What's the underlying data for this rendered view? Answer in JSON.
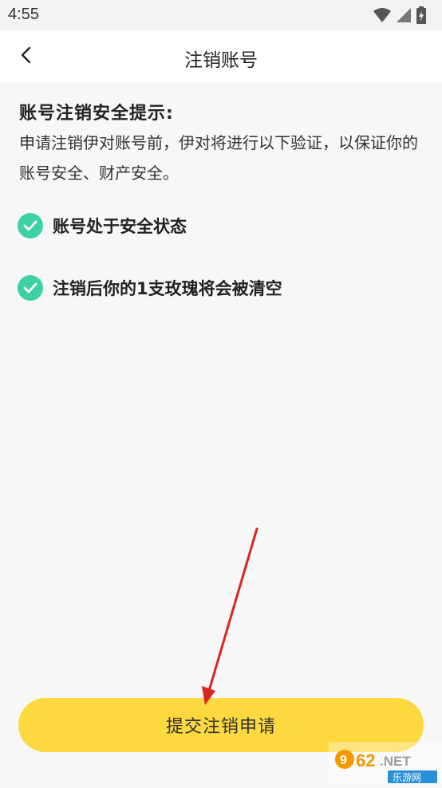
{
  "status_bar": {
    "time": "4:55"
  },
  "header": {
    "title": "注销账号"
  },
  "notice": {
    "title": "账号注销安全提示:",
    "description": "申请注销伊对账号前，伊对将进行以下验证，以保证你的账号安全、财产安全。"
  },
  "checks": [
    {
      "label": "账号处于安全状态"
    },
    {
      "label": "注销后你的1支玫瑰将会被清空"
    }
  ],
  "submit": {
    "label": "提交注销申请"
  },
  "watermark": {
    "text": "962.NET",
    "subtext": "乐游网"
  },
  "colors": {
    "check_green": "#3ed0a6",
    "button_yellow": "#fdd83f",
    "arrow_red": "#d8261e"
  }
}
